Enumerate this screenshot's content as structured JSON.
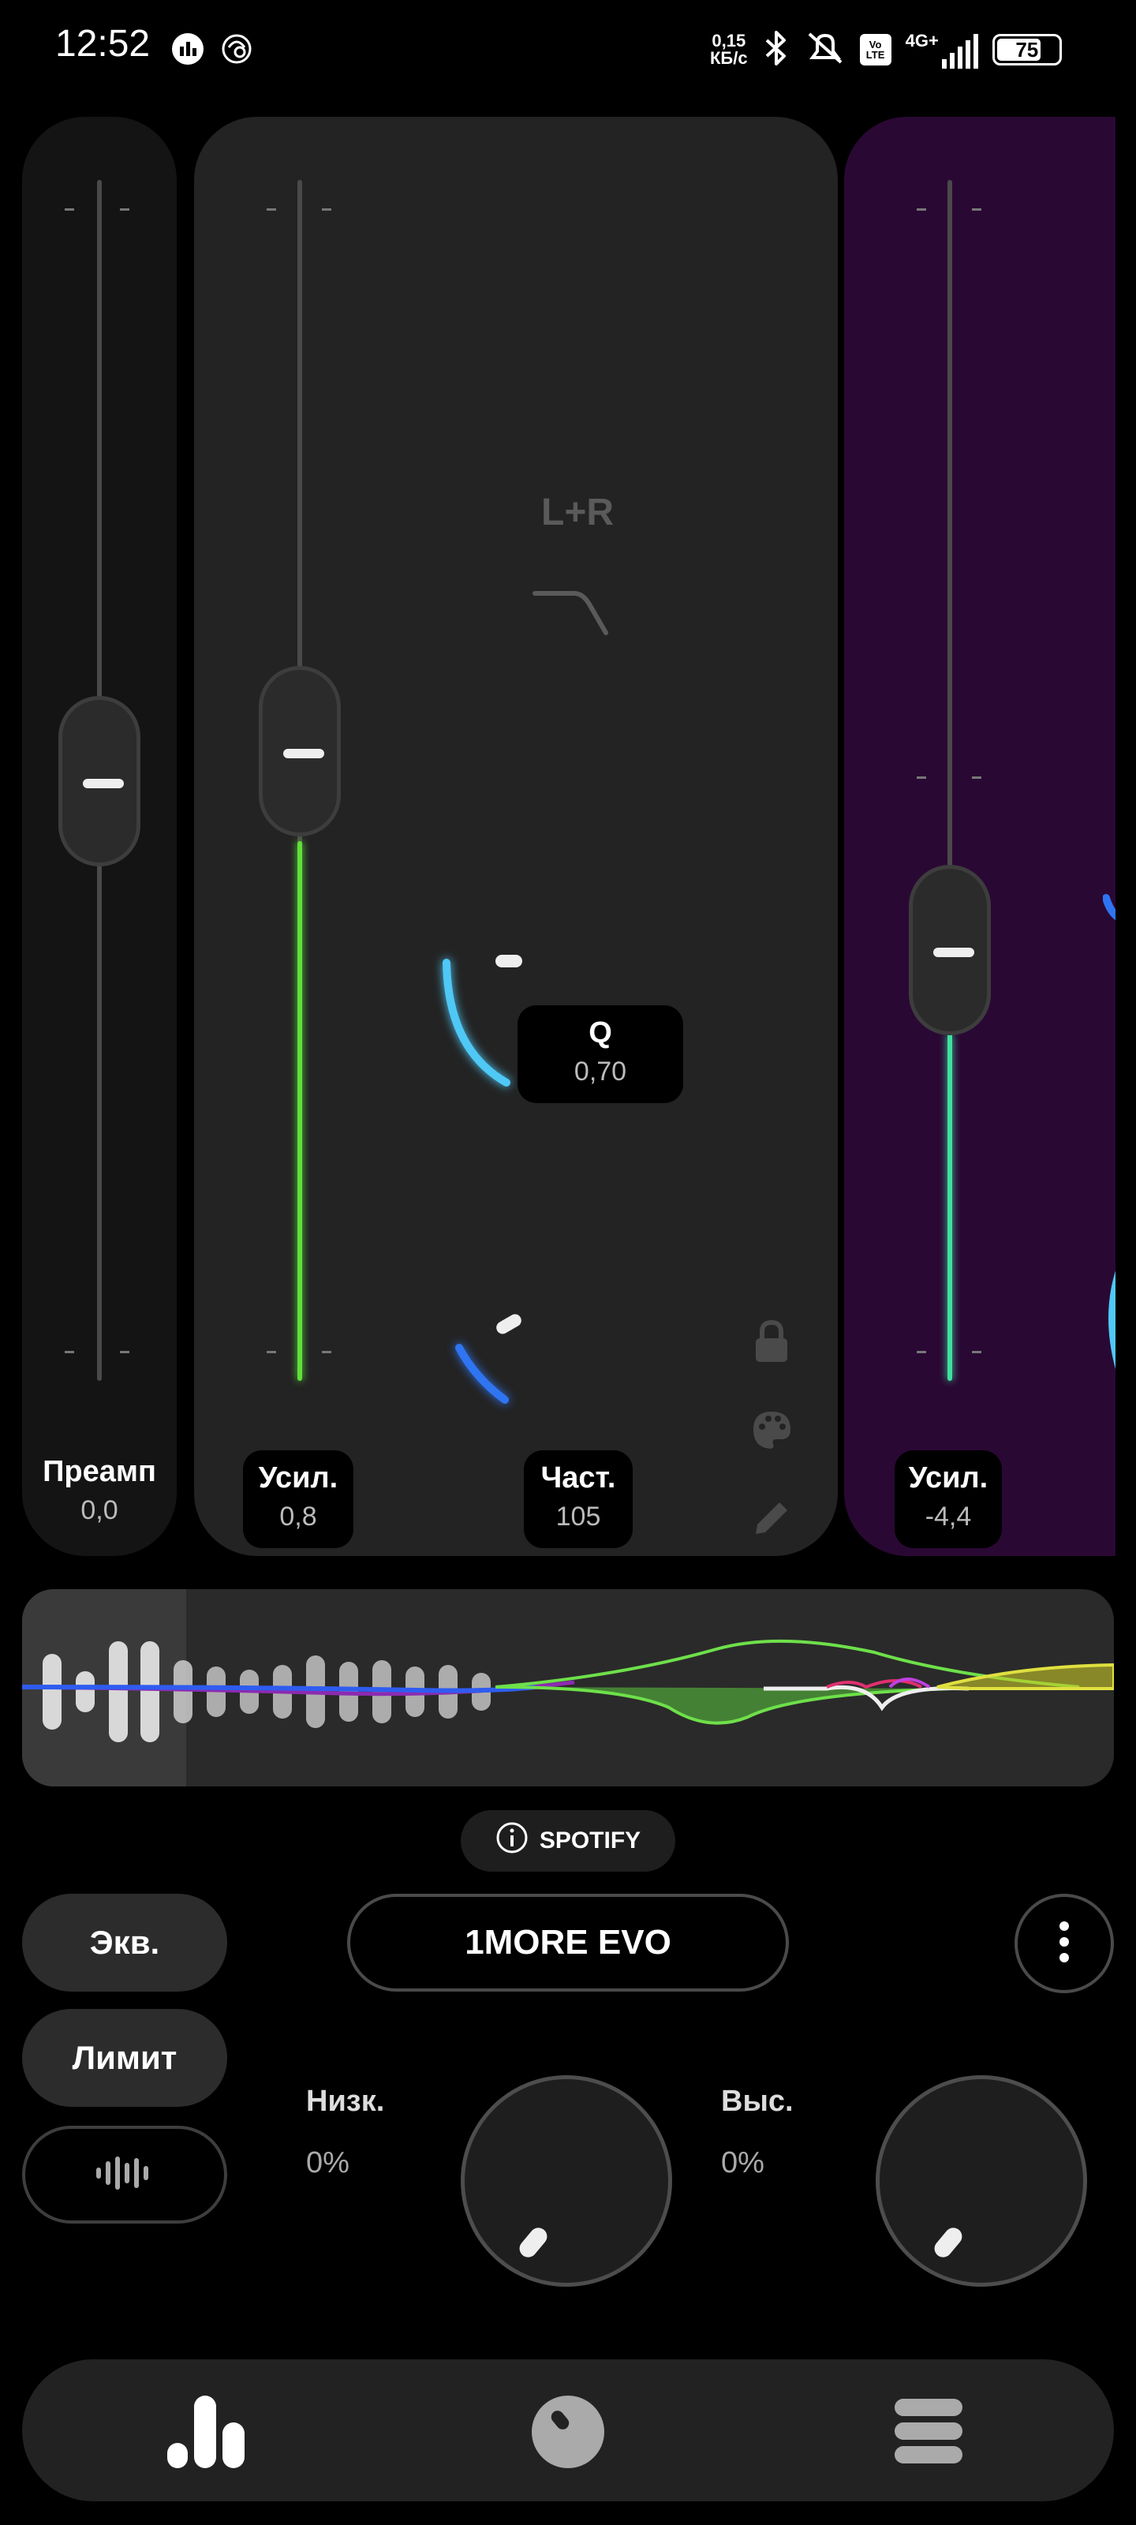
{
  "status_bar": {
    "time": "12:52",
    "net_speed_value": "0,15",
    "net_speed_unit": "КБ/с",
    "network": "4G+",
    "battery": "75",
    "icons": [
      "equalizer-app-icon",
      "chrome-like-icon",
      "bluetooth-icon",
      "mute-icon",
      "volte-icon",
      "signal-icon",
      "battery-icon"
    ]
  },
  "preamp": {
    "label": "Преамп",
    "value": "0,0",
    "level": 0.0
  },
  "band1": {
    "channel": "L+R",
    "filter_icon": "low-shelf-filter-icon",
    "gain_label": "Усил.",
    "gain_value": "0,8",
    "q_label": "Q",
    "q_value": "0,70",
    "freq_label": "Част.",
    "freq_value": "105",
    "accent": "#5fe03a",
    "side_icons": [
      "lock-icon",
      "palette-icon",
      "pencil-icon"
    ]
  },
  "band2": {
    "gain_label": "Усил.",
    "gain_value": "-4,4",
    "accent": "#3fe0a0",
    "background": "#2a0834"
  },
  "source": {
    "label": "SPOTIFY"
  },
  "buttons": {
    "eq": "Экв.",
    "limiter": "Лимит",
    "device": "1MORE EVO",
    "more": "more-options-icon"
  },
  "bass": {
    "label": "Низк.",
    "value": "0%"
  },
  "treble": {
    "label": "Выс.",
    "value": "0%"
  },
  "nav": [
    "equalizer-tab-icon",
    "knob-tab-icon",
    "menu-tab-icon"
  ]
}
